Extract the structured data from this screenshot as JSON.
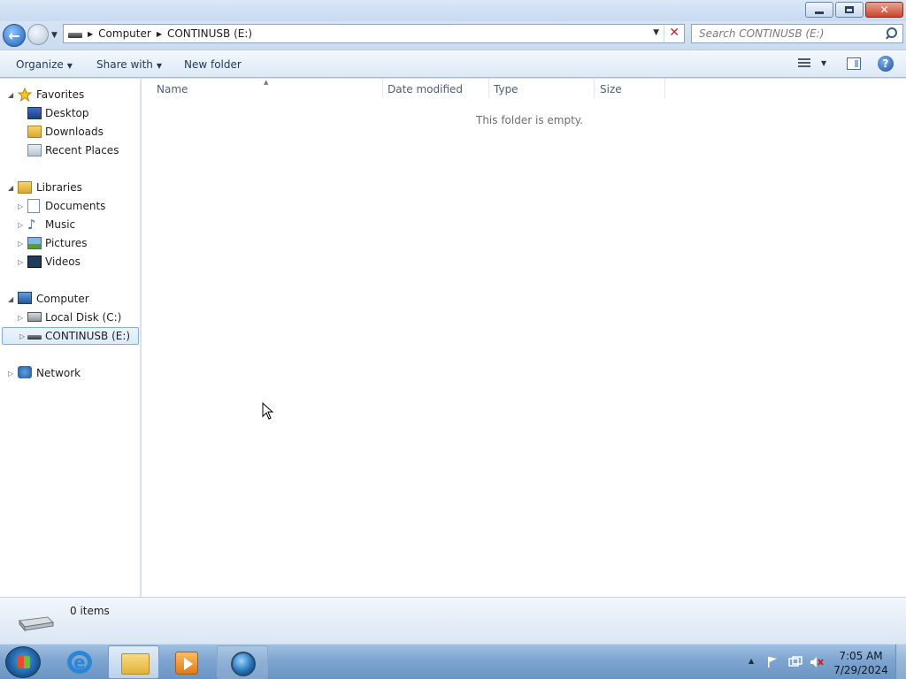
{
  "address": {
    "crumbs": [
      "Computer",
      "CONTINUSB (E:)"
    ]
  },
  "search": {
    "placeholder": "Search CONTINUSB (E:)"
  },
  "toolbar": {
    "organize": "Organize",
    "share_with": "Share with",
    "new_folder": "New folder"
  },
  "sidebar": {
    "favorites": "Favorites",
    "desktop": "Desktop",
    "downloads": "Downloads",
    "recent_places": "Recent Places",
    "libraries": "Libraries",
    "documents": "Documents",
    "music": "Music",
    "pictures": "Pictures",
    "videos": "Videos",
    "computer": "Computer",
    "local_disk": "Local Disk (C:)",
    "continusb": "CONTINUSB (E:)",
    "network": "Network"
  },
  "columns": {
    "name": "Name",
    "date_modified": "Date modified",
    "type": "Type",
    "size": "Size"
  },
  "content": {
    "empty_message": "This folder is empty."
  },
  "details": {
    "items_count": "0 items"
  },
  "taskbar": {
    "time": "7:05 AM",
    "date": "7/29/2024"
  },
  "icons": {
    "back": "back-arrow-icon",
    "forward": "forward-arrow-icon",
    "search": "search-icon",
    "help": "help-icon",
    "drive": "usb-drive-icon"
  }
}
